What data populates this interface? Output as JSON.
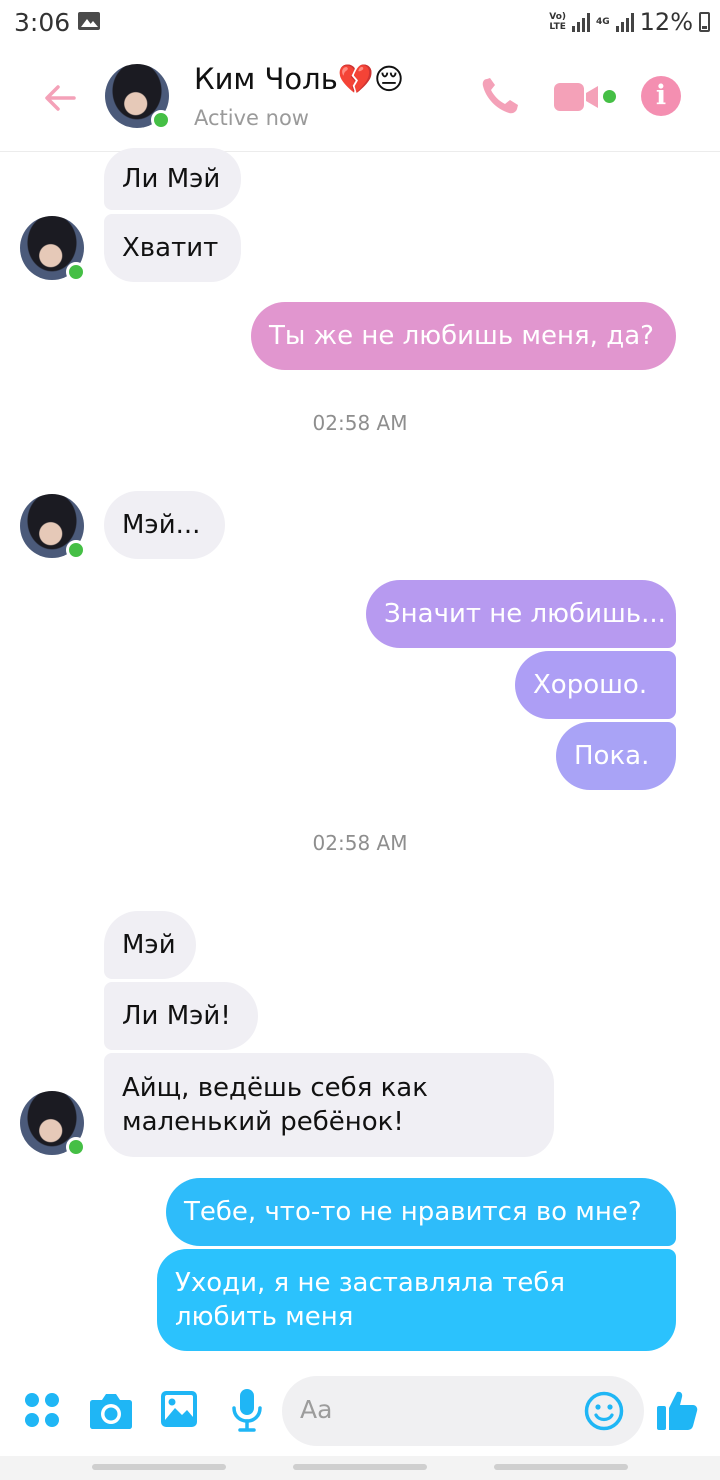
{
  "status_bar": {
    "time": "3:06",
    "volte": "Vo) LTE",
    "network": "4G",
    "battery": "12%"
  },
  "header": {
    "name": "Ким Чоль💔😔",
    "status": "Active now",
    "accent_color": "#f48fb1"
  },
  "messages": [
    {
      "side": "in",
      "text": "Ли Мэй"
    },
    {
      "side": "in",
      "text": "Хватит"
    },
    {
      "side": "out",
      "text": "Ты же не любишь меня, да?",
      "color": "#e196cf"
    },
    {
      "side": "in",
      "text": "Мэй..."
    },
    {
      "side": "out",
      "text": "Значит не любишь...",
      "color": "#b79af0"
    },
    {
      "side": "out",
      "text": "Хорошо.",
      "color": "#ad9ef5"
    },
    {
      "side": "out",
      "text": "Пока.",
      "color": "#a9a3f6"
    },
    {
      "side": "in",
      "text": "Мэй"
    },
    {
      "side": "in",
      "text": "Ли Мэй!"
    },
    {
      "side": "in",
      "text": "Айщ, ведёшь себя как маленький ребёнок!"
    },
    {
      "side": "out",
      "text": "Тебе, что-то не нравится во мне?",
      "color": "#2ebcfa"
    },
    {
      "side": "out",
      "text": "Уходи, я не заставляла тебя любить меня",
      "color": "#2bc2fd"
    }
  ],
  "timestamps": [
    "02:58 AM",
    "02:58 AM"
  ],
  "composer": {
    "placeholder": "Aa",
    "icon_color": "#1fb6f5"
  },
  "icons": [
    "back-arrow-icon",
    "phone-icon",
    "video-icon",
    "info-icon",
    "menu-dots-icon",
    "camera-icon",
    "gallery-icon",
    "microphone-icon",
    "emoji-icon",
    "like-icon"
  ]
}
